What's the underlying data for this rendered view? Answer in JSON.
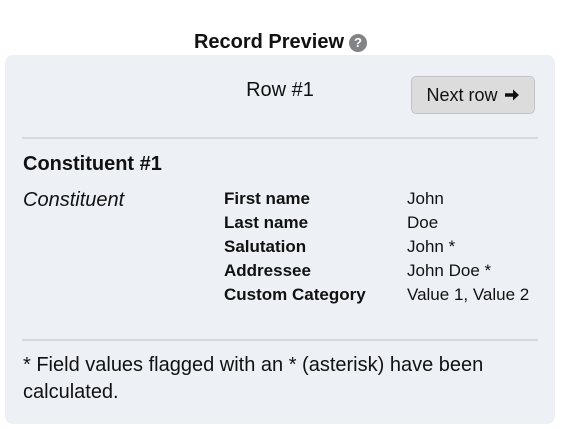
{
  "header": {
    "title": "Record Preview",
    "help_icon": "?"
  },
  "preview": {
    "row_label": "Row #1",
    "next_button_label": "Next row",
    "next_button_icon": "arrow-right-icon"
  },
  "record": {
    "section_title": "Constituent #1",
    "record_type": "Constituent",
    "fields": [
      {
        "label": "First name",
        "value": "John"
      },
      {
        "label": "Last name",
        "value": "Doe"
      },
      {
        "label": "Salutation",
        "value": "John *"
      },
      {
        "label": "Addressee",
        "value": "John Doe *"
      },
      {
        "label": "Custom Category",
        "value": "Value 1, Value 2"
      }
    ]
  },
  "footnote": "* Field values flagged with an * (asterisk) have been calculated.",
  "colors": {
    "panel_background": "#edf1f5",
    "divider": "#d5dae0",
    "button_background": "#dcdcdc",
    "help_icon": "#808487"
  }
}
